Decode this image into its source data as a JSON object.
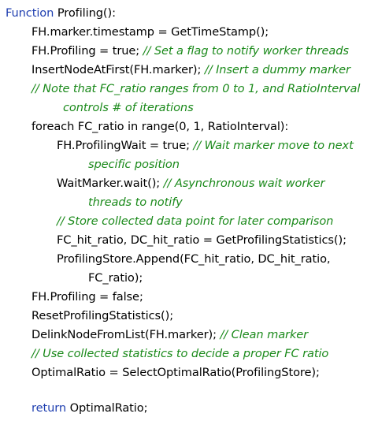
{
  "algorithm": {
    "header": {
      "keyword": "Function",
      "name": "Profiling():"
    },
    "lines": [
      {
        "code": "FH.marker.timestamp = GetTimeStamp();"
      },
      {
        "code": "FH.Profiling = true;",
        "comment": "// Set a flag to notify worker threads"
      },
      {
        "code": "InsertNodeAtFirst(FH.marker);",
        "comment": "// Insert a dummy marker"
      },
      {
        "comment": "// Note that FC_ratio ranges from 0 to 1, and RatioInterval"
      },
      {
        "comment": "controls # of iterations"
      },
      {
        "code": "foreach FC_ratio in range(0, 1, RatioInterval):"
      },
      {
        "code": "FH.ProfilingWait = true;",
        "comment": "// Wait marker move to next"
      },
      {
        "comment": "specific position"
      },
      {
        "code": "WaitMarker.wait();",
        "comment": "// Asynchronous wait worker"
      },
      {
        "comment": "threads to notify"
      },
      {
        "comment": "// Store collected data point for later comparison"
      },
      {
        "code": "FC_hit_ratio, DC_hit_ratio = GetProfilingStatistics();"
      },
      {
        "code": "ProfilingStore.Append(FC_hit_ratio, DC_hit_ratio,"
      },
      {
        "code": "FC_ratio);"
      },
      {
        "code": "FH.Profiling = false;"
      },
      {
        "code": "ResetProfilingStatistics();"
      },
      {
        "code": "DelinkNodeFromList(FH.marker);",
        "comment": "// Clean marker"
      },
      {
        "comment": "// Use collected statistics to decide a proper FC ratio"
      },
      {
        "code": "OptimalRatio = SelectOptimalRatio(ProfilingStore);"
      },
      {
        "keyword": "return",
        "code": "OptimalRatio;"
      }
    ]
  },
  "colors": {
    "keyword": "#1f3fb0",
    "comment": "#1b8a1b",
    "code": "#000000"
  }
}
